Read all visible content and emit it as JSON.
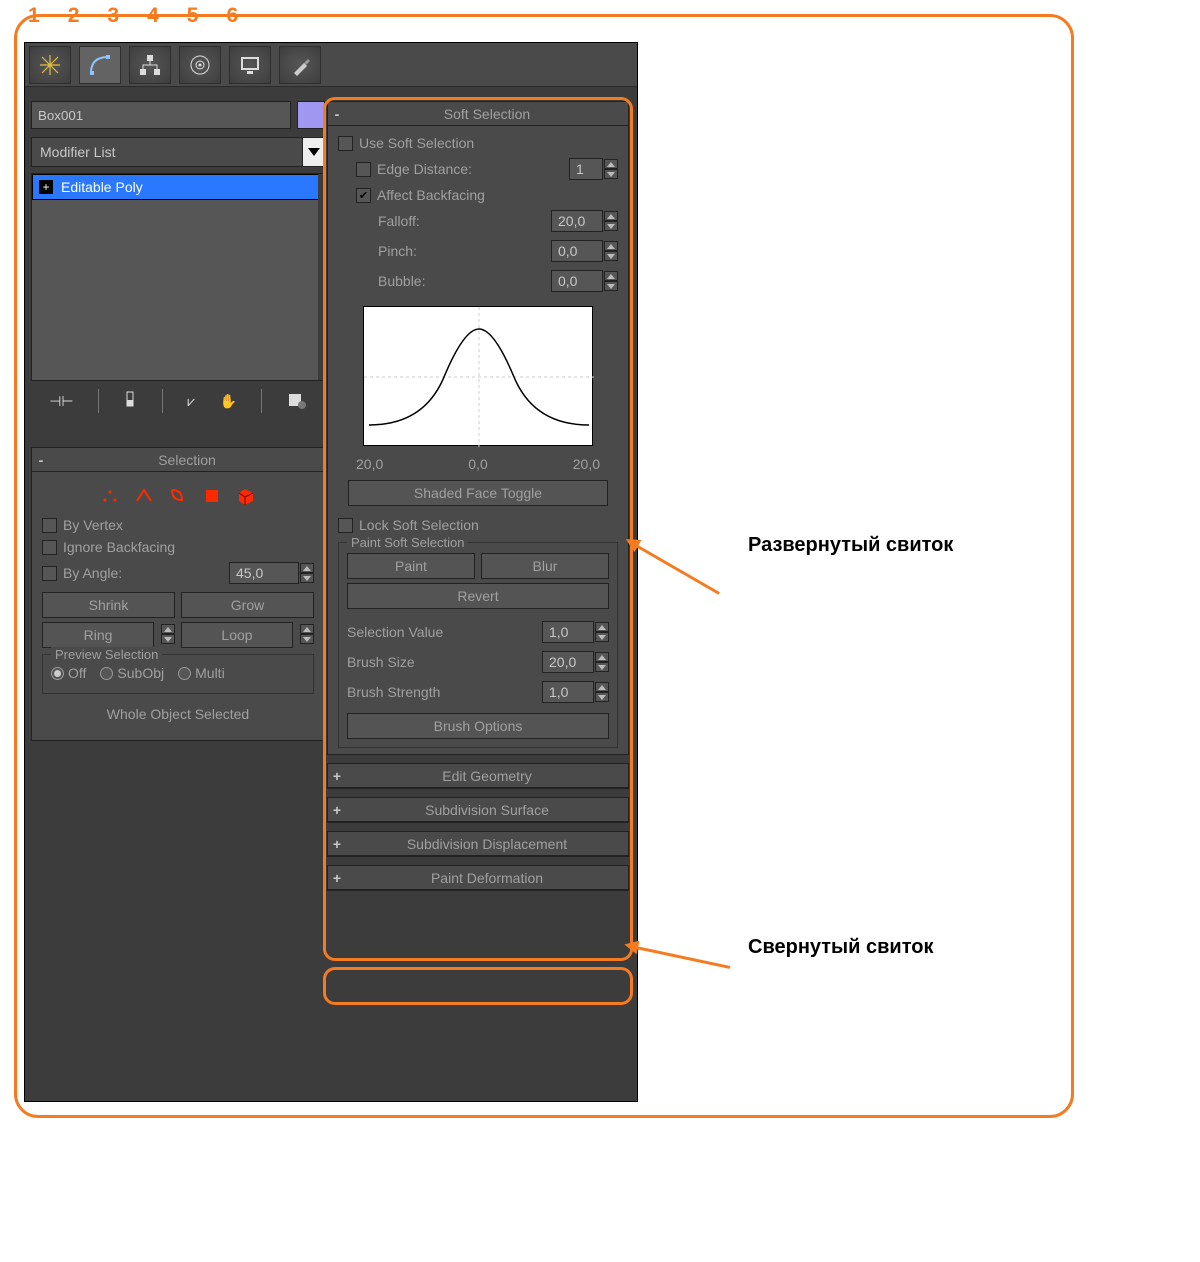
{
  "top_numbers": [
    "1",
    "2",
    "3",
    "4",
    "5",
    "6"
  ],
  "object_name": "Box001",
  "modifier_list_label": "Modifier List",
  "stack_item": "Editable Poly",
  "callouts": {
    "expanded": "Развернутый свиток",
    "collapsed": "Свернутый свиток"
  },
  "selection": {
    "title": "Selection",
    "by_vertex": "By Vertex",
    "ignore_bf": "Ignore Backfacing",
    "by_angle": "By Angle:",
    "by_angle_val": "45,0",
    "shrink": "Shrink",
    "grow": "Grow",
    "ring": "Ring",
    "loop": "Loop",
    "preview": "Preview Selection",
    "off": "Off",
    "subobj": "SubObj",
    "multi": "Multi",
    "whole": "Whole Object Selected"
  },
  "soft": {
    "title": "Soft Selection",
    "use": "Use Soft Selection",
    "edge_dist": "Edge Distance:",
    "edge_dist_val": "1",
    "affect_bf": "Affect Backfacing",
    "falloff": "Falloff:",
    "falloff_val": "20,0",
    "pinch": "Pinch:",
    "pinch_val": "0,0",
    "bubble": "Bubble:",
    "bubble_val": "0,0",
    "ax_left": "20,0",
    "ax_mid": "0,0",
    "ax_right": "20,0",
    "shaded": "Shaded Face Toggle",
    "lock": "Lock Soft Selection",
    "paint_grp": "Paint Soft Selection",
    "paint": "Paint",
    "blur": "Blur",
    "revert": "Revert",
    "sel_val": "Selection Value",
    "sel_val_v": "1,0",
    "brush_size": "Brush Size",
    "brush_size_v": "20,0",
    "brush_str": "Brush Strength",
    "brush_str_v": "1,0",
    "brush_opt": "Brush Options"
  },
  "rolls": {
    "edit_geom": "Edit Geometry",
    "subd_surf": "Subdivision Surface",
    "subd_disp": "Subdivision Displacement",
    "paint_def": "Paint Deformation"
  }
}
